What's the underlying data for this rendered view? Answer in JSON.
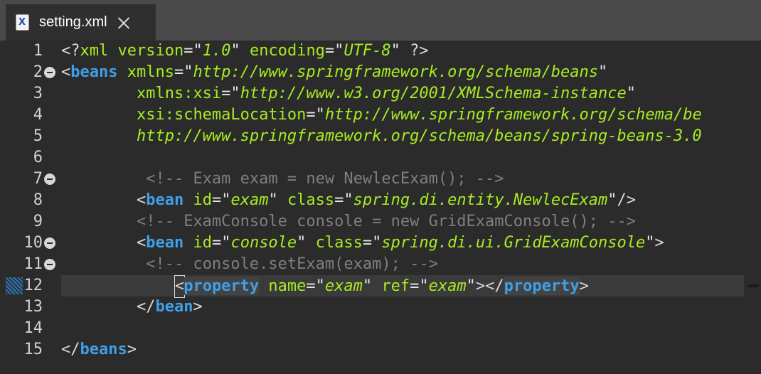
{
  "tab": {
    "title": "setting.xml",
    "icon": "xml-file-icon"
  },
  "editor": {
    "current_line": 12,
    "lines": [
      {
        "num": "1"
      },
      {
        "num": "2"
      },
      {
        "num": "3"
      },
      {
        "num": "4"
      },
      {
        "num": "5"
      },
      {
        "num": "6"
      },
      {
        "num": "7"
      },
      {
        "num": "8"
      },
      {
        "num": "9"
      },
      {
        "num": "10"
      },
      {
        "num": "11"
      },
      {
        "num": "12"
      },
      {
        "num": "13"
      },
      {
        "num": "14"
      },
      {
        "num": "15"
      }
    ],
    "code": {
      "l1": {
        "open": "<?",
        "name": "xml",
        "a1": "version",
        "v1": "1.0",
        "a2": "encoding",
        "v2": "UTF-8",
        "close": "?>"
      },
      "l2": {
        "name": "beans",
        "a": "xmlns",
        "v": "http://www.springframework.org/schema/beans"
      },
      "l3": {
        "a": "xmlns:xsi",
        "v": "http://www.w3.org/2001/XMLSchema-instance"
      },
      "l4": {
        "a": "xsi:schemaLocation",
        "v": "http://www.springframework.org/schema/be"
      },
      "l5": {
        "v": "http://www.springframework.org/schema/beans/spring-beans-3.0"
      },
      "l7": {
        "comment": "<!-- Exam exam = new NewlecExam(); -->"
      },
      "l8": {
        "name": "bean",
        "a1": "id",
        "v1": "exam",
        "a2": "class",
        "v2": "spring.di.entity.NewlecExam"
      },
      "l9": {
        "comment": "<!-- ExamConsole console = new GridExamConsole(); -->"
      },
      "l10": {
        "name": "bean",
        "a1": "id",
        "v1": "console",
        "a2": "class",
        "v2": "spring.di.ui.GridExamConsole"
      },
      "l11": {
        "comment": "<!-- console.setExam(exam); -->"
      },
      "l12": {
        "name": "property",
        "a1": "name",
        "v1": "exam",
        "a2": "ref",
        "v2": "exam"
      },
      "l13": {
        "name": "bean"
      },
      "l15": {
        "name": "beans"
      }
    }
  }
}
